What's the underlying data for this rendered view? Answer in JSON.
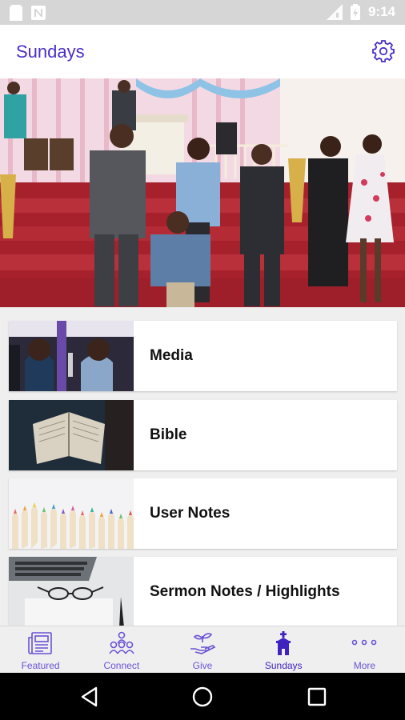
{
  "status_bar": {
    "time": "9:14"
  },
  "app_bar": {
    "title": "Sundays"
  },
  "menu_items": [
    {
      "label": "Media"
    },
    {
      "label": "Bible"
    },
    {
      "label": "User Notes"
    },
    {
      "label": "Sermon Notes / Highlights"
    }
  ],
  "bottom_nav": [
    {
      "label": "Featured",
      "icon": "newspaper-icon"
    },
    {
      "label": "Connect",
      "icon": "people-icon"
    },
    {
      "label": "Give",
      "icon": "hand-plant-icon"
    },
    {
      "label": "Sundays",
      "icon": "church-icon",
      "active": true
    },
    {
      "label": "More",
      "icon": "more-dots-icon"
    }
  ],
  "colors": {
    "accent": "#4a2fc7",
    "nav_label": "#6a52d6"
  }
}
